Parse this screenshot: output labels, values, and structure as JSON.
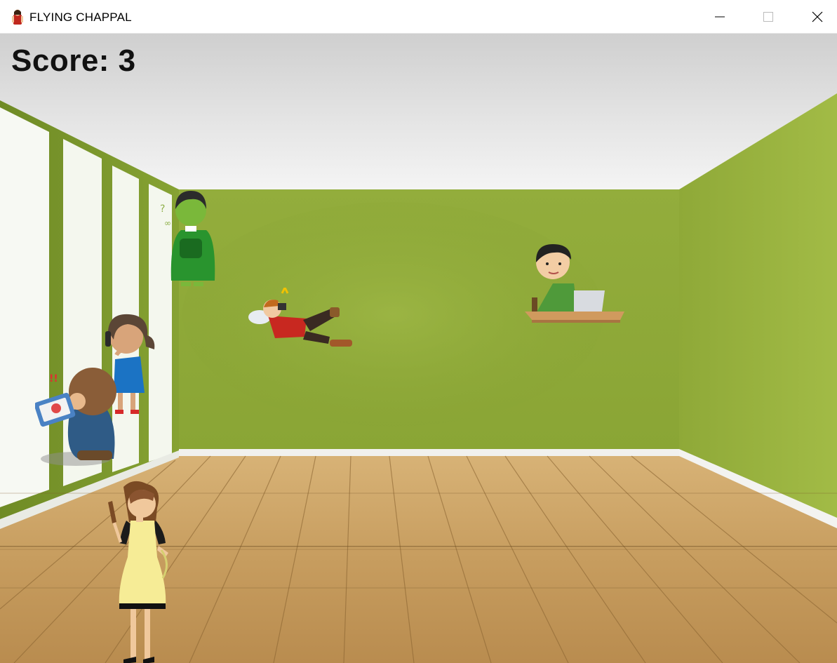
{
  "window": {
    "title": "FLYING CHAPPAL",
    "icon": "chappal-app-icon",
    "controls": [
      "minimize-icon",
      "maximize-icon",
      "close-icon"
    ]
  },
  "hud": {
    "score_text": "Score: 3"
  },
  "colors": {
    "wall": "#8fa93a",
    "ceiling": "#e2e2e2",
    "floor": "#c9a165",
    "baseboard": "#f2f2f2"
  },
  "characters": [
    {
      "name": "sick-boy-character",
      "description": "green-faced boy"
    },
    {
      "name": "sleeping-man-character",
      "description": "man lying down with phone"
    },
    {
      "name": "laptop-man-character",
      "description": "man working at laptop"
    },
    {
      "name": "phone-woman-character",
      "description": "woman talking on phone"
    },
    {
      "name": "tablet-boy-character",
      "description": "boy sitting with tablet"
    },
    {
      "name": "mother-player-character",
      "description": "woman in apron holding chappal"
    }
  ]
}
